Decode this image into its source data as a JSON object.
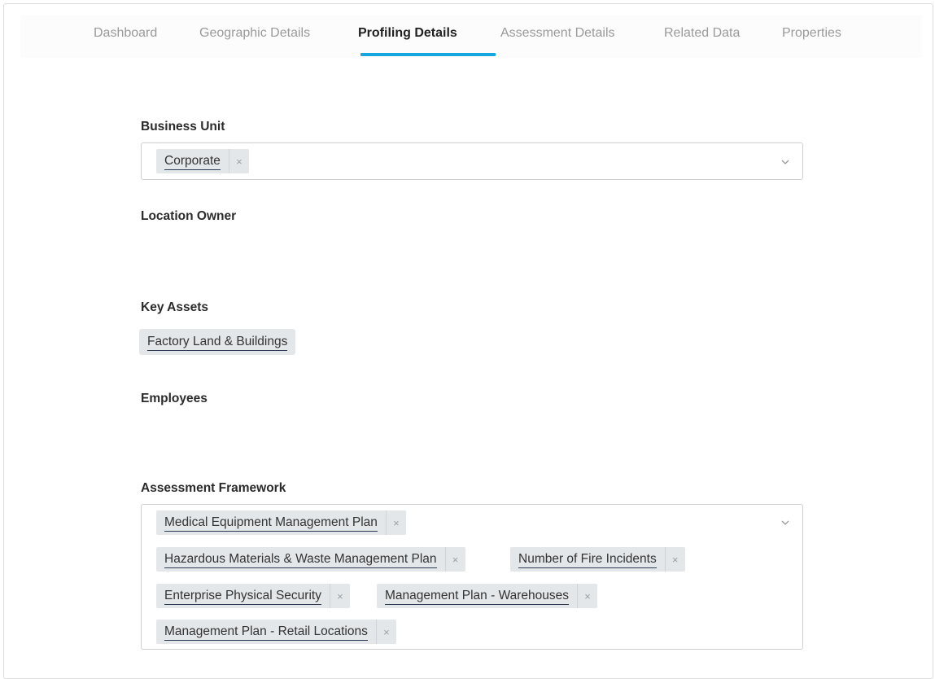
{
  "tabs": [
    {
      "label": "Dashboard"
    },
    {
      "label": "Geographic Details"
    },
    {
      "label": "Profiling Details"
    },
    {
      "label": "Assessment Details"
    },
    {
      "label": "Related Data"
    },
    {
      "label": "Properties"
    }
  ],
  "active_tab": "Profiling Details",
  "colors": {
    "accent": "#18a6e0",
    "chip_bg": "#e4e7ea"
  },
  "fields": {
    "business_unit": {
      "label": "Business Unit",
      "chips": [
        "Corporate"
      ]
    },
    "location_owner": {
      "label": "Location Owner"
    },
    "key_assets": {
      "label": "Key Assets",
      "chips": [
        "Factory Land & Buildings"
      ]
    },
    "employees": {
      "label": "Employees"
    },
    "assessment_framework": {
      "label": "Assessment Framework",
      "chips": [
        "Medical Equipment Management Plan",
        "Hazardous Materials & Waste Management Plan",
        "Number of Fire Incidents",
        "Enterprise Physical Security",
        "Management Plan - Warehouses",
        "Management Plan - Retail Locations"
      ]
    }
  },
  "icons": {
    "remove": "close-icon",
    "dropdown": "chevron-down-icon",
    "remove_glyph": "×"
  }
}
